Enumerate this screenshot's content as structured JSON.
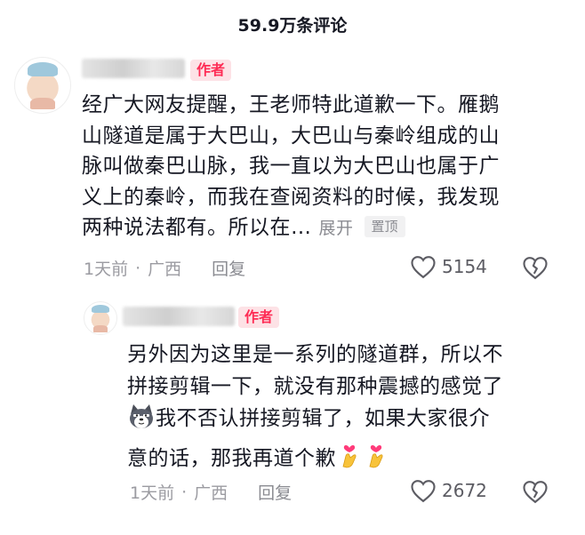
{
  "header": {
    "title": "59.9万条评论"
  },
  "comments": [
    {
      "author_tag": "作者",
      "line1": "经广大网友提醒，王老师特此道歉一下。雁鹅",
      "line2": "山隧道是属于大巴山，大巴山与秦岭组成的山",
      "line3": "脉叫做秦巴山脉，我一直以为大巴山也属于广",
      "line4": "义上的秦岭，而我在查阅资料的时候，我发现",
      "line5": "两种说法都有。所以在…",
      "expand_label": "展开",
      "pin_label": "置顶",
      "time": "1天前",
      "dot": "·",
      "location": "广西",
      "reply_label": "回复",
      "likes": "5154"
    },
    {
      "author_tag": "作者",
      "line1": "另外因为这里是一系列的隧道群，所以不",
      "line2": "拼接剪辑一下，就没有那种震撼的感觉了",
      "line3": "我不否认拼接剪辑了，如果大家很介",
      "line4": "意的话，那我再道个歉",
      "time": "1天前",
      "dot": "·",
      "location": "广西",
      "reply_label": "回复",
      "likes": "2672"
    }
  ],
  "colors": {
    "accent": "#fe2c55",
    "tag_bg": "#fde2e6",
    "muted": "#9b9ba1"
  },
  "icons": [
    "heart-outline-icon",
    "broken-heart-icon",
    "husky-emoji-icon",
    "finger-heart-emoji-icon"
  ]
}
